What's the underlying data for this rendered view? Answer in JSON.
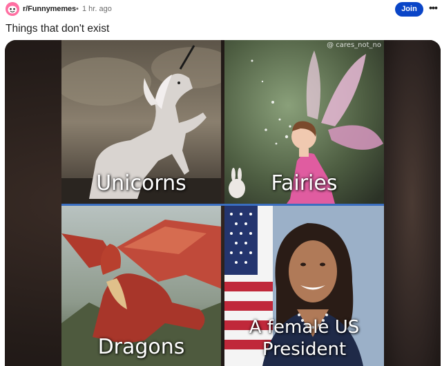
{
  "post": {
    "subreddit": "r/Funnymemes",
    "separator": "•",
    "time": "1 hr. ago",
    "join_label": "Join",
    "more_label": "•••",
    "title": "Things that don't exist"
  },
  "meme": {
    "watermark": "@ cares_not_no",
    "panels": [
      {
        "caption": "Unicorns",
        "icon": "unicorn-image"
      },
      {
        "caption": "Fairies",
        "icon": "fairy-image"
      },
      {
        "caption": "Dragons",
        "icon": "dragon-image"
      },
      {
        "caption_line1": "A female US",
        "caption_line2": "President",
        "icon": "portrait-image"
      }
    ]
  },
  "colors": {
    "join_button": "#0a45c7",
    "avatar": "#ff6fa2",
    "divider": "#3a6ec0"
  }
}
